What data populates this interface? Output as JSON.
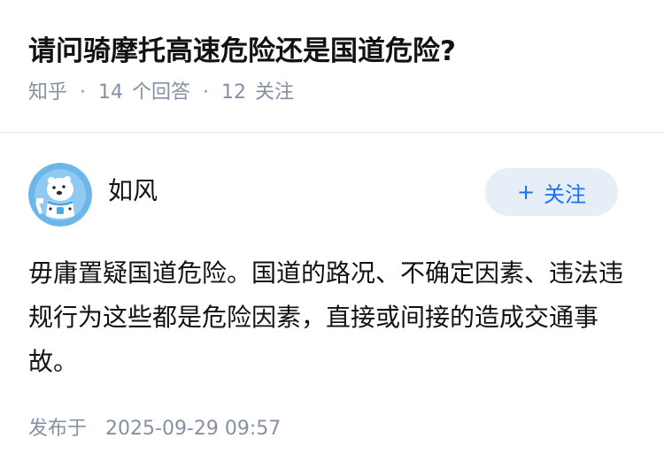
{
  "question": {
    "title": "请问骑摩托高速危险还是国道危险?",
    "source": "知乎",
    "answer_count": "14",
    "answer_label": "个回答",
    "follow_count": "12",
    "follow_label": "关注"
  },
  "answer": {
    "author_name": "如风",
    "avatar_icon": "polar-bear-avatar-icon",
    "follow_button_label": "关注",
    "follow_button_icon": "plus-icon",
    "content": "毋庸置疑国道危险。国道的路况、不确定因素、违法违规行为这些都是危险因素，直接或间接的造成交通事故。",
    "published_label": "发布于",
    "published_time": "2025-09-29 09:57"
  },
  "colors": {
    "title": "#121212",
    "meta": "#8590a6",
    "accent": "#1772f6",
    "follow_button_bg": "#e6eef8",
    "divider": "#ebebeb"
  }
}
